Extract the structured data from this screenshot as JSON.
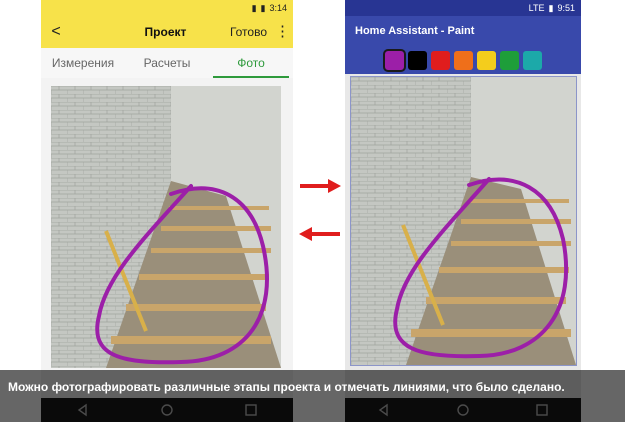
{
  "left_app": {
    "status_time": "3:14",
    "toolbar": {
      "back_glyph": "<",
      "title": "Проект",
      "done_label": "Готово",
      "more_glyph": "⋮"
    },
    "tabs": [
      {
        "label": "Измерения",
        "active": false
      },
      {
        "label": "Расчеты",
        "active": false
      },
      {
        "label": "Фото",
        "active": true
      }
    ],
    "accent_color": "#f7e24a",
    "tab_active_color": "#2e9a3c"
  },
  "right_app": {
    "status_time": "9:51",
    "status_icon_label": "LTE",
    "title": "Home Assistant - Paint",
    "palette": [
      {
        "name": "purple",
        "color": "#9c1fa8",
        "selected": true
      },
      {
        "name": "black",
        "color": "#000000",
        "selected": false
      },
      {
        "name": "red",
        "color": "#e01d1d",
        "selected": false
      },
      {
        "name": "orange",
        "color": "#ef6f1a",
        "selected": false
      },
      {
        "name": "yellow",
        "color": "#f4cd1c",
        "selected": false
      },
      {
        "name": "green",
        "color": "#1e9e3a",
        "selected": false
      },
      {
        "name": "teal",
        "color": "#1ca9a9",
        "selected": false
      }
    ],
    "accent_color": "#3949ab"
  },
  "arrows_color": "#e01d1d",
  "drawing_color": "#9c1fa8",
  "caption": "Можно фотографировать различные этапы проекта и отмечать линиями, что было сделано."
}
